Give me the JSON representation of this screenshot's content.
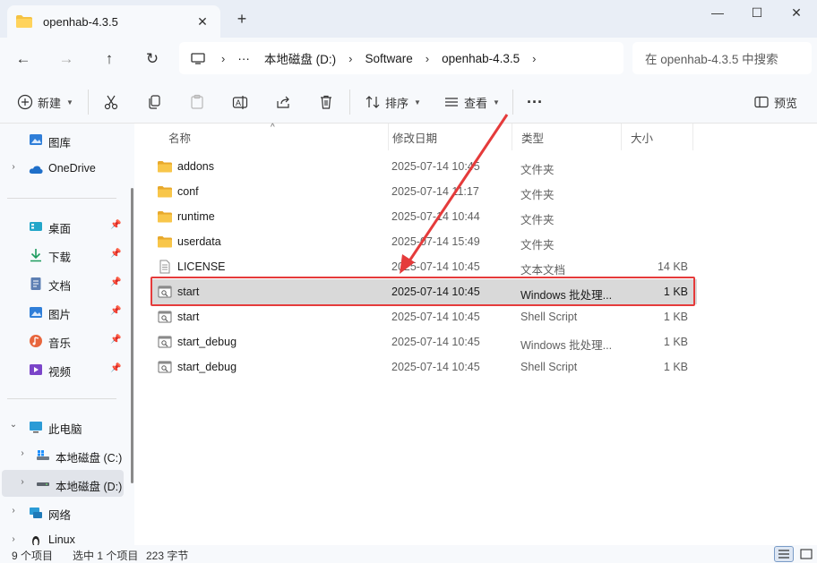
{
  "window": {
    "tab_title": "openhab-4.3.5",
    "tab_close": "✕",
    "new_tab": "+",
    "minimize": "—",
    "maximize": "☐",
    "close": "✕"
  },
  "nav": {
    "back": "←",
    "forward": "→",
    "up": "↑",
    "refresh": "↻",
    "more": "···",
    "breadcrumbs": [
      "本地磁盘 (D:)",
      "Software",
      "openhab-4.3.5"
    ],
    "search_placeholder": "在 openhab-4.3.5 中搜索"
  },
  "toolbar": {
    "new_label": "新建",
    "sort_label": "排序",
    "view_label": "查看",
    "more_label": "···",
    "preview_label": "预览"
  },
  "sidebar": {
    "items": [
      {
        "label": "图库",
        "icon": "gallery-icon"
      },
      {
        "label": "OneDrive",
        "icon": "onedrive-icon"
      },
      {
        "label": "桌面",
        "icon": "desktop-icon",
        "pinned": true
      },
      {
        "label": "下载",
        "icon": "download-icon",
        "pinned": true
      },
      {
        "label": "文档",
        "icon": "document-icon",
        "pinned": true
      },
      {
        "label": "图片",
        "icon": "pictures-icon",
        "pinned": true
      },
      {
        "label": "音乐",
        "icon": "music-icon",
        "pinned": true
      },
      {
        "label": "视频",
        "icon": "video-icon",
        "pinned": true
      },
      {
        "label": "此电脑",
        "icon": "this-pc-icon"
      },
      {
        "label": "本地磁盘 (C:)",
        "icon": "drive-c-icon"
      },
      {
        "label": "本地磁盘 (D:)",
        "icon": "drive-d-icon",
        "selected": true
      },
      {
        "label": "网络",
        "icon": "network-icon"
      },
      {
        "label": "Linux",
        "icon": "linux-icon"
      }
    ]
  },
  "columns": {
    "name": "名称",
    "date": "修改日期",
    "type": "类型",
    "size": "大小"
  },
  "files": [
    {
      "name": "addons",
      "date": "2025-07-14 10:45",
      "type": "文件夹",
      "size": "",
      "icon": "folder-icon"
    },
    {
      "name": "conf",
      "date": "2025-07-14 11:17",
      "type": "文件夹",
      "size": "",
      "icon": "folder-icon"
    },
    {
      "name": "runtime",
      "date": "2025-07-14 10:44",
      "type": "文件夹",
      "size": "",
      "icon": "folder-icon"
    },
    {
      "name": "userdata",
      "date": "2025-07-14 15:49",
      "type": "文件夹",
      "size": "",
      "icon": "folder-icon"
    },
    {
      "name": "LICENSE",
      "date": "2025-07-14 10:45",
      "type": "文本文档",
      "size": "14 KB",
      "icon": "text-file-icon"
    },
    {
      "name": "start",
      "date": "2025-07-14 10:45",
      "type": "Windows 批处理...",
      "size": "1 KB",
      "icon": "script-file-icon",
      "selected": true
    },
    {
      "name": "start",
      "date": "2025-07-14 10:45",
      "type": "Shell Script",
      "size": "1 KB",
      "icon": "script-file-icon"
    },
    {
      "name": "start_debug",
      "date": "2025-07-14 10:45",
      "type": "Windows 批处理...",
      "size": "1 KB",
      "icon": "script-file-icon"
    },
    {
      "name": "start_debug",
      "date": "2025-07-14 10:45",
      "type": "Shell Script",
      "size": "1 KB",
      "icon": "script-file-icon"
    }
  ],
  "status": {
    "count": "9 个项目",
    "selected": "选中 1 个项目",
    "size": "223 字节"
  },
  "colors": {
    "annotation_red": "#e53b3b",
    "folder_yellow": "#f5c242",
    "selection_gray": "#d9d9d9"
  }
}
